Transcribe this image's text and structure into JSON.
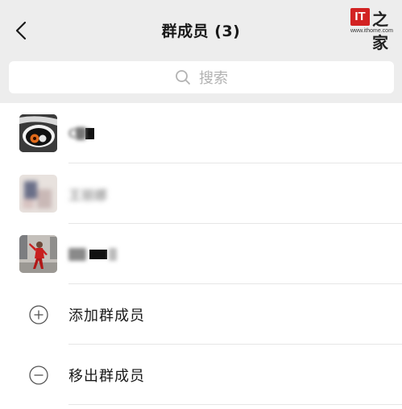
{
  "header": {
    "title": "群成员 (3)",
    "back_icon": "chevron-left-icon"
  },
  "watermark": {
    "logo_letters": "IT",
    "logo_char": "之家",
    "url": "www.ithome.com"
  },
  "search": {
    "placeholder": "搜索",
    "icon": "search-icon"
  },
  "members": [
    {
      "name": "CYC",
      "avatar": "eye-illustration"
    },
    {
      "name": "王丽娜",
      "avatar": "blurred-photo"
    },
    {
      "name": "",
      "avatar": "figure-red-outfit"
    }
  ],
  "actions": {
    "add_label": "添加群成员",
    "add_icon": "plus-circle-icon",
    "remove_label": "移出群成员",
    "remove_icon": "minus-circle-icon"
  },
  "colors": {
    "background": "#ededed",
    "surface": "#ffffff",
    "text": "#191919",
    "placeholder": "#b2b2b2",
    "logo_red": "#d22222"
  }
}
